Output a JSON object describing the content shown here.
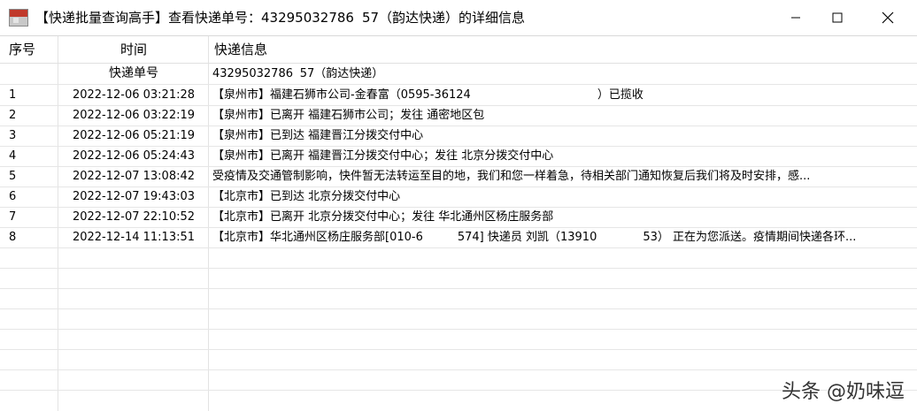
{
  "window": {
    "title": "【快递批量查询高手】查看快递单号：43295032786   57（韵达快递）的详细信息",
    "minimize_icon": "minimize-icon",
    "maximize_icon": "maximize-icon",
    "close_icon": "close-icon"
  },
  "table": {
    "columns": [
      "序号",
      "时间",
      "快递信息"
    ],
    "tracking_row": {
      "label": "快递单号",
      "value": "43295032786   57（韵达快递）"
    },
    "rows": [
      {
        "idx": "1",
        "time": "2022-12-06 03:21:28",
        "info": "【泉州市】福建石狮市公司-金春富（0595-36124           ）已揽收"
      },
      {
        "idx": "2",
        "time": "2022-12-06 03:22:19",
        "info": "【泉州市】已离开 福建石狮市公司；发往 通密地区包"
      },
      {
        "idx": "3",
        "time": "2022-12-06 05:21:19",
        "info": "【泉州市】已到达 福建晋江分拨交付中心"
      },
      {
        "idx": "4",
        "time": "2022-12-06 05:24:43",
        "info": "【泉州市】已离开 福建晋江分拨交付中心；发往 北京分拨交付中心"
      },
      {
        "idx": "5",
        "time": "2022-12-07 13:08:42",
        "info": "受疫情及交通管制影响，快件暂无法转运至目的地，我们和您一样着急，待相关部门通知恢复后我们将及时安排，感..."
      },
      {
        "idx": "6",
        "time": "2022-12-07 19:43:03",
        "info": "【北京市】已到达 北京分拨交付中心"
      },
      {
        "idx": "7",
        "time": "2022-12-07 22:10:52",
        "info": "【北京市】已离开 北京分拨交付中心；发往 华北通州区杨庄服务部"
      },
      {
        "idx": "8",
        "time": "2022-12-14 11:13:51",
        "info": "【北京市】华北通州区杨庄服务部[010-6   574] 快递员 刘凯（13910    53） 正在为您派送。疫情期间快递各环..."
      }
    ]
  },
  "watermark": "头条 @奶味逗"
}
